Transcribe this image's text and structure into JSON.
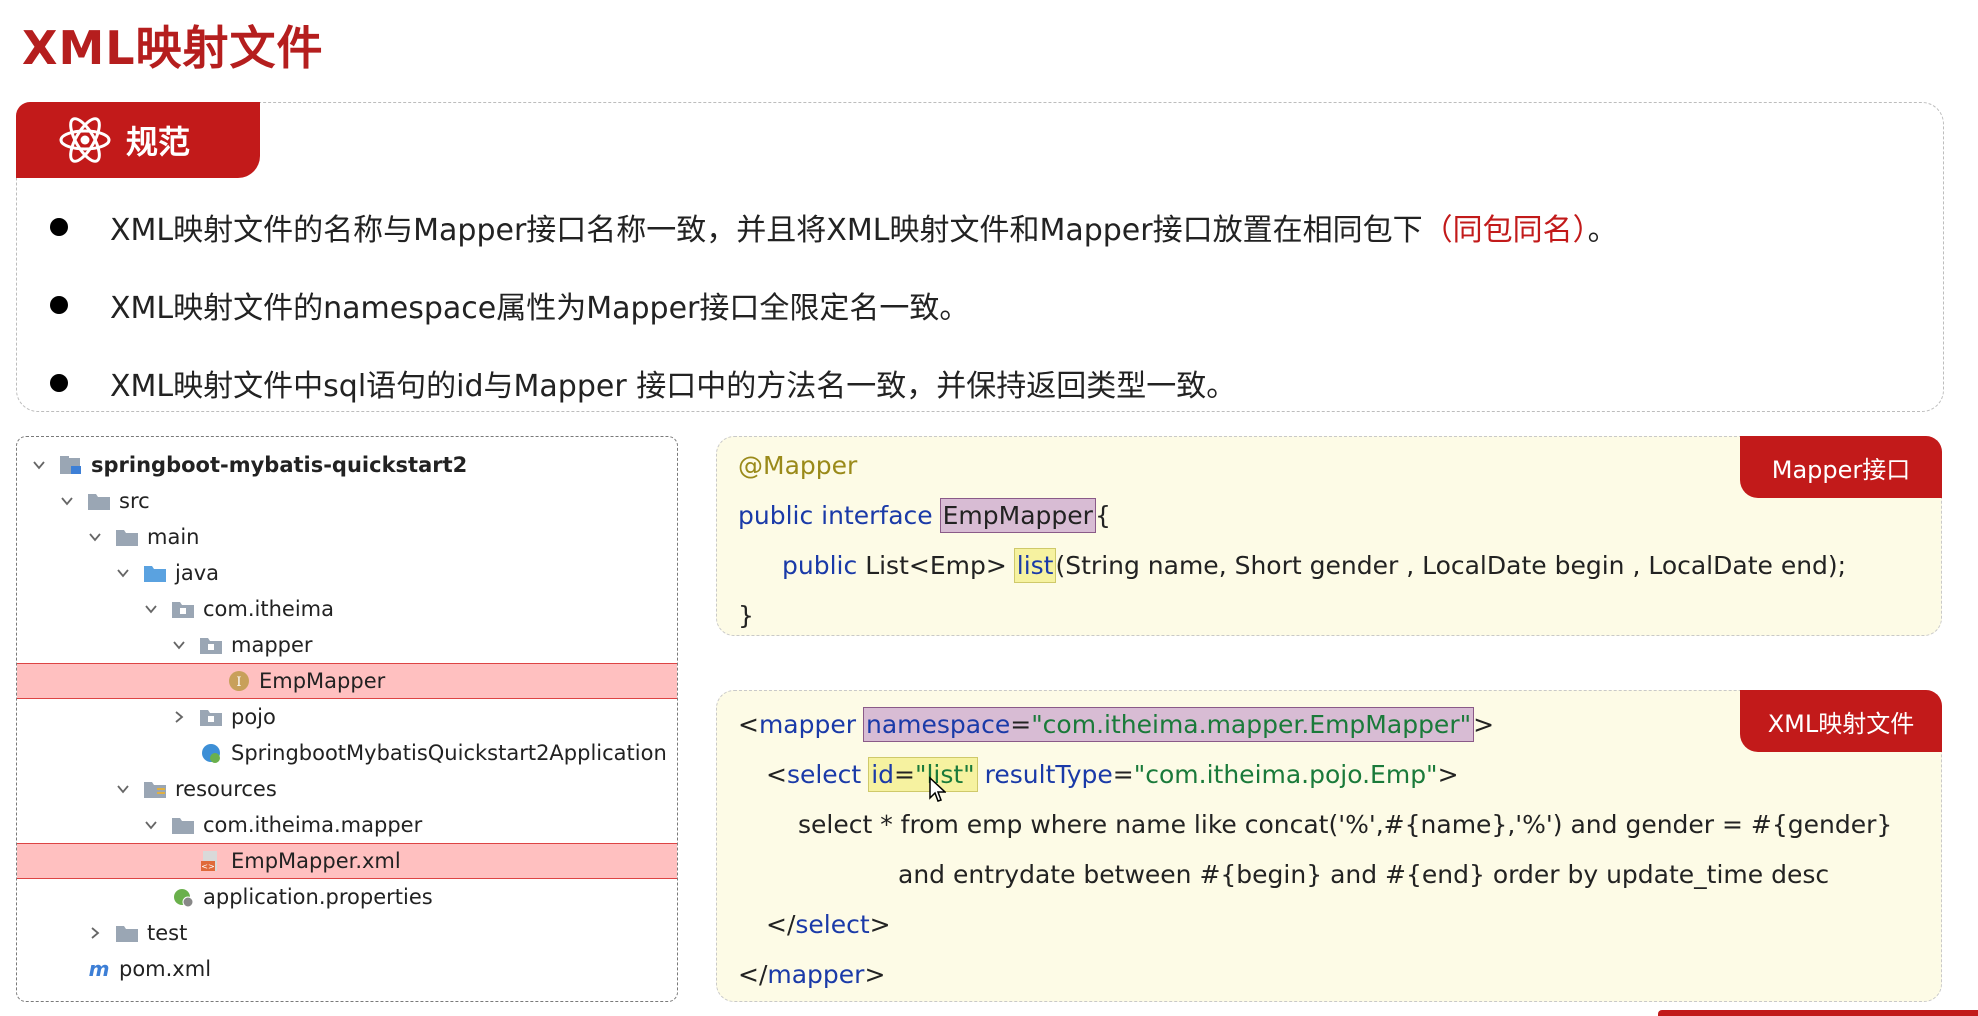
{
  "title": "XML映射文件",
  "rules": {
    "tag": "规范",
    "items": [
      {
        "text": "XML映射文件的名称与Mapper接口名称一致，并且将XML映射文件和Mapper接口放置在相同包下",
        "highlight": "（同包同名）",
        "suffix": "。"
      },
      {
        "text": "XML映射文件的namespace属性为Mapper接口全限定名一致。"
      },
      {
        "text": "XML映射文件中sql语句的id与Mapper 接口中的方法名一致，并保持返回类型一致。"
      }
    ]
  },
  "tree": {
    "items": [
      {
        "label": "springboot-mybatis-quickstart2",
        "icon": "module-icon"
      },
      {
        "label": "src",
        "icon": "folder-icon"
      },
      {
        "label": "main",
        "icon": "folder-icon"
      },
      {
        "label": "java",
        "icon": "source-folder-icon"
      },
      {
        "label": "com.itheima",
        "icon": "package-icon"
      },
      {
        "label": "mapper",
        "icon": "package-icon"
      },
      {
        "label": "EmpMapper",
        "icon": "interface-icon",
        "highlighted": true
      },
      {
        "label": "pojo",
        "icon": "package-icon"
      },
      {
        "label": "SpringbootMybatisQuickstart2Application",
        "icon": "spring-class-icon"
      },
      {
        "label": "resources",
        "icon": "resources-folder-icon"
      },
      {
        "label": "com.itheima.mapper",
        "icon": "folder-icon"
      },
      {
        "label": "EmpMapper.xml",
        "icon": "xml-file-icon",
        "highlighted": true
      },
      {
        "label": "application.properties",
        "icon": "properties-icon"
      },
      {
        "label": "test",
        "icon": "folder-icon"
      },
      {
        "label": "pom.xml",
        "icon": "maven-icon"
      }
    ]
  },
  "mapper_card": {
    "tag": "Mapper接口",
    "annotation": "@Mapper",
    "kw_public_interface": "public interface",
    "class_name": "EmpMapper",
    "open_brace": "{",
    "kw_public": "public",
    "return_type": "List<Emp>",
    "method_name": "list",
    "params": "(String name, Short gender , LocalDate begin , LocalDate end);",
    "close_brace": "}"
  },
  "xml_card": {
    "tag": "XML映射文件",
    "l1_open": "<",
    "l1_tag": "mapper",
    "l1_attr": "namespace",
    "l1_eq": "=",
    "l1_val": "\"com.itheima.mapper.EmpMapper\"",
    "l1_close": ">",
    "l2_open": "<",
    "l2_tag": "select",
    "l2_id_attr": "id",
    "l2_id_eq": "=",
    "l2_id_val": "\"list\"",
    "l2_rt_attr": "resultType",
    "l2_rt_eq": "=",
    "l2_rt_val": "\"com.itheima.pojo.Emp\"",
    "l2_close": ">",
    "sql1": "select * from emp where name like concat('%',#{name},'%') and gender = #{gender}",
    "sql2": "and entrydate between #{begin} and #{end} order by update_time desc",
    "l5_open": "</",
    "l5_tag": "select",
    "l5_close": ">",
    "l6_open": "</",
    "l6_tag": "mapper",
    "l6_close": ">"
  },
  "colors": {
    "accent": "#c21a1a",
    "keyword": "#1a3aa8",
    "string": "#1a7a3a",
    "annotation": "#9a8a1a",
    "card_bg": "#fdfbe6",
    "tree_highlight": "#ffc0c0"
  }
}
